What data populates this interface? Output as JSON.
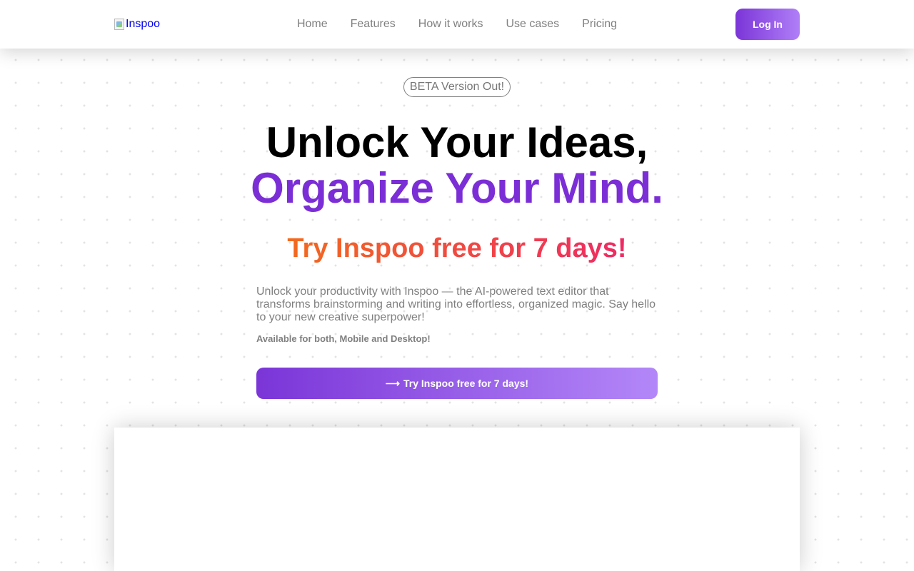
{
  "nav": {
    "logo_alt": "Inspoo",
    "links": [
      "Home",
      "Features",
      "How it works",
      "Use cases",
      "Pricing"
    ],
    "login_label": "Log In"
  },
  "hero": {
    "badge": "BETA Version Out!",
    "title_line1": "Unlock Your Ideas,",
    "title_line2": "Organize Your Mind.",
    "trial_heading": "Try Inspoo free for 7 days!",
    "description": "Unlock your productivity with Inspoo — the AI-powered text editor that transforms brainstorming and writing into effortless, organized magic. Say hello to your new creative superpower!",
    "platform_note": "Available for both, Mobile and Desktop!",
    "cta_label": "Try Inspoo free for 7 days!",
    "cta_icon": "arrow-right-icon"
  },
  "colors": {
    "accent": "#7b2ed6",
    "button_gradient_start": "#7b35d8",
    "button_gradient_end": "#b387f8",
    "trial_gradient_start": "#f26a1e",
    "trial_gradient_end": "#ee2a64",
    "muted_text": "#808080"
  }
}
